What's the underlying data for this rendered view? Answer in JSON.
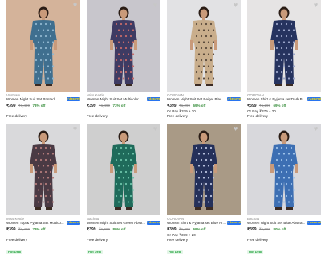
{
  "products": [
    {
      "brand": "Vastvam",
      "title": "Women Night Suit Set Printed",
      "price": "₹399",
      "mrp": "₹1,499",
      "off": "73% off",
      "emi": "",
      "delivery": "Free delivery",
      "badge": "Hot Deal",
      "assured_icon": "flipkart-assured-badge",
      "image_bg": "#d4b39a",
      "garment": "#3f6f8f",
      "pattern": "#8fb6cf"
    },
    {
      "brand": "Miss Kettle",
      "title": "Women Night Suit Set Multicolor",
      "price": "₹399",
      "mrp": "₹1,499",
      "off": "73% off",
      "emi": "",
      "delivery": "Free delivery",
      "badge": "Hot Deal",
      "assured_icon": "flipkart-assured-badge",
      "image_bg": "#c8c6cc",
      "garment": "#3e3b63",
      "pattern": "#c46a6a"
    },
    {
      "brand": "GORDIAN",
      "title": "Women Night Suit Set Beige, Blac...",
      "price": "₹399",
      "mrp": "₹1,299",
      "off": "69% off",
      "emi": "Or Pay ₹379 + 20",
      "delivery": "Free delivery",
      "badge": "Hot Deal",
      "assured_icon": "flipkart-assured-badge",
      "image_bg": "#e2e2e4",
      "garment": "#c9ae8c",
      "pattern": "#5a4a3c"
    },
    {
      "brand": "GORDIAN",
      "title": "Women Shirt & Pyjama set Dark Bl...",
      "price": "₹399",
      "mrp": "₹1,299",
      "off": "69% off",
      "emi": "Or Pay ₹379 + 20",
      "delivery": "Free delivery",
      "badge": "Hot Deal",
      "assured_icon": "flipkart-assured-badge",
      "image_bg": "#e6e4e4",
      "garment": "#26335f",
      "pattern": "#9aa4c8"
    },
    {
      "brand": "Miss Kettle",
      "title": "Women Top & Pyjama Set Multico...",
      "price": "₹399",
      "mrp": "₹1,499",
      "off": "73% off",
      "emi": "",
      "delivery": "Free delivery",
      "badge": "Hot Deal",
      "assured_icon": "flipkart-assured-badge",
      "image_bg": "#d9d9db",
      "garment": "#4a3a44",
      "pattern": "#b27a7a"
    },
    {
      "brand": "Bachau",
      "title": "Women Night Suit Set Green Abstr...",
      "price": "₹399",
      "mrp": "₹1,999",
      "off": "80% off",
      "emi": "",
      "delivery": "Free delivery",
      "badge": "Hot Deal",
      "assured_icon": "flipkart-assured-badge",
      "image_bg": "#cfcfcf",
      "garment": "#1f6b5b",
      "pattern": "#6cc3a8"
    },
    {
      "brand": "GORDIAN",
      "title": "Women Shirt & Pyjama set Blue Pr...",
      "price": "₹399",
      "mrp": "₹1,299",
      "off": "69% off",
      "emi": "Or Pay ₹379 + 20",
      "delivery": "Free delivery",
      "badge": "Hot Deal",
      "assured_icon": "flipkart-assured-badge",
      "image_bg": "#a99a86",
      "garment": "#24305a",
      "pattern": "#b9c2de"
    },
    {
      "brand": "Bachau",
      "title": "Women Night Suit Set Blue Abstra...",
      "price": "₹399",
      "mrp": "₹1,999",
      "off": "80% off",
      "emi": "",
      "delivery": "Free delivery",
      "badge": "Hot Deal",
      "assured_icon": "flipkart-assured-badge",
      "image_bg": "#d8d8dc",
      "garment": "#3d6fb3",
      "pattern": "#9fc3ea"
    }
  ]
}
